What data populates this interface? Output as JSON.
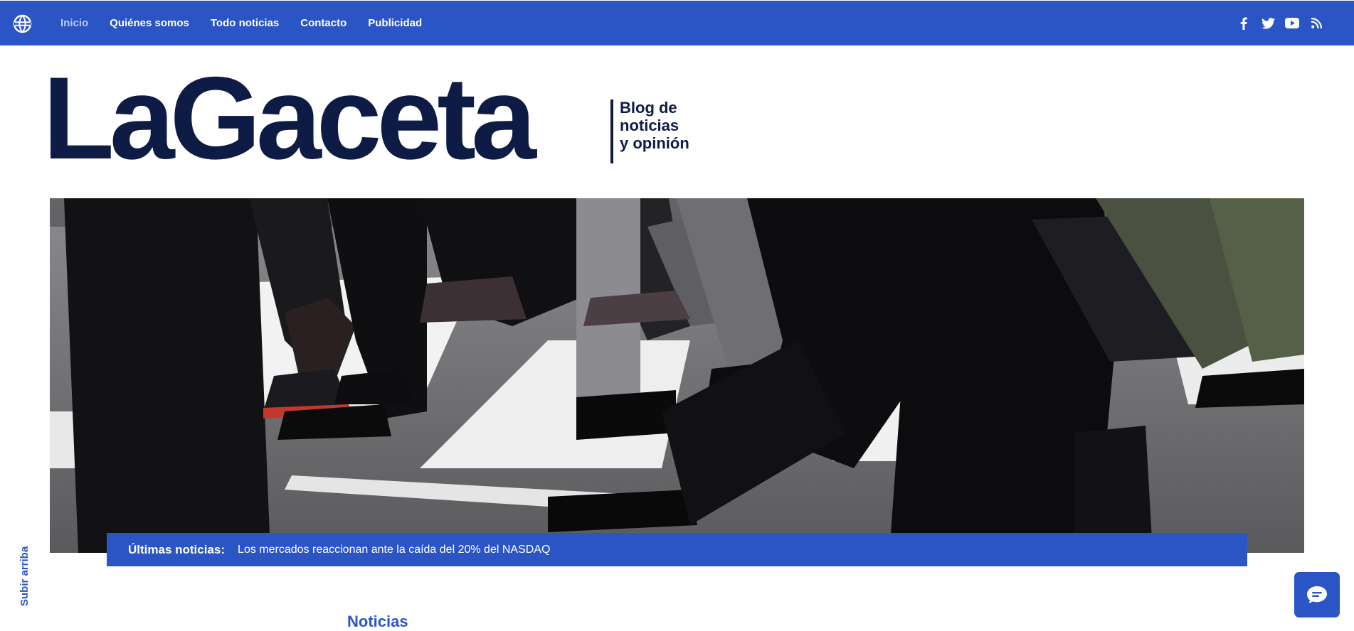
{
  "header": {
    "logo_icon": "globe-icon",
    "nav": [
      {
        "label": "Inicio",
        "active": true
      },
      {
        "label": "Quiénes somos",
        "active": false
      },
      {
        "label": "Todo noticias",
        "active": false
      },
      {
        "label": "Contacto",
        "active": false
      },
      {
        "label": "Publicidad",
        "active": false
      }
    ],
    "social": [
      "facebook-icon",
      "twitter-icon",
      "youtube-icon",
      "rss-icon"
    ],
    "bar_color": "#2b55c5"
  },
  "brand": {
    "name": "LaGaceta",
    "tagline": [
      "Blog de",
      "noticias",
      "y opinión"
    ],
    "color": "#0e1c45"
  },
  "hero": {
    "image_description": "feet-on-crosswalk-photo"
  },
  "ticker": {
    "label": "Últimas noticias:",
    "text": "Los mercados reaccionan ante la caída del 20% del NASDAQ"
  },
  "scroll_top": {
    "label": "Subir arriba"
  },
  "section": {
    "title": "Noticias"
  },
  "chat": {
    "icon": "chat-bubble-icon"
  }
}
